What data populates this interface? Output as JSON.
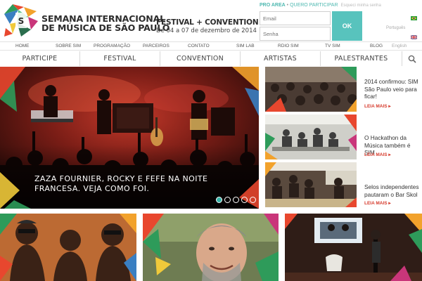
{
  "brand": {
    "line1": "SEMANA INTERNACIONAL",
    "line2": "DE MÚSICA DE SÃO PAULO",
    "tagline_title": "FESTIVAL + CONVENTION",
    "tagline_dates": "De 04 a 07 de dezembro de 2014"
  },
  "login": {
    "area_label": "PRO AREA",
    "join_label": "QUERO PARTICIPAR",
    "forgot_label": "Esqueci minha senha",
    "email_placeholder": "Email",
    "password_placeholder": "Senha",
    "ok_label": "OK"
  },
  "languages": [
    {
      "label": "Português",
      "flag": "brazil-flag-icon"
    },
    {
      "label": "English",
      "flag": "uk-flag-icon"
    }
  ],
  "top_nav": [
    "HOME",
    "SOBRE SIM",
    "PROGRAMAÇÃO",
    "PARCEIROS",
    "CONTATO",
    "SIM LAB",
    "RDIO SIM",
    "TV SIM",
    "BLOG"
  ],
  "main_nav": [
    "PARTICIPE",
    "FESTIVAL",
    "CONVENTION",
    "ARTISTAS",
    "PALESTRANTES"
  ],
  "search_icon": "magnifier-icon",
  "hero": {
    "caption_line1": "ZAZA FOURNIER, ROCKY E FEFE NA NOITE",
    "caption_line2": "FRANCESA. VEJA COMO FOI.",
    "slide_count": 5,
    "active_slide": 1
  },
  "news": [
    {
      "title": "2014 confirmou: SIM São Paulo veio para ficar!",
      "more": "LEIA MAIS ▸"
    },
    {
      "title": "O Hackathon da Música também é SIM",
      "more": "LEIA MAIS ▸"
    },
    {
      "title": "Selos independentes pautaram o Bar Skol",
      "more": "LEIA MAIS ▸"
    }
  ],
  "colors": {
    "teal": "#58c3bd",
    "red_link": "#d63c2e",
    "dot_active": "#36b3a8"
  }
}
